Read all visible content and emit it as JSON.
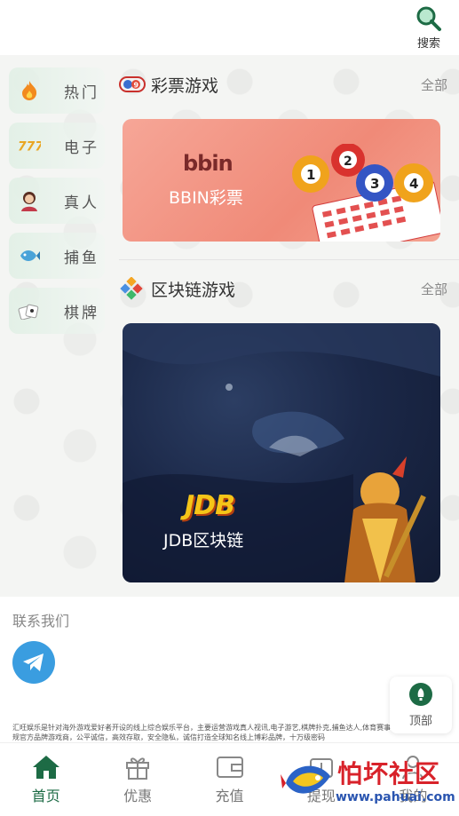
{
  "header": {
    "search_label": "搜索"
  },
  "sidebar": {
    "items": [
      {
        "label": "热门",
        "icon": "fire-icon"
      },
      {
        "label": "电子",
        "icon": "slot-777-icon"
      },
      {
        "label": "真人",
        "icon": "live-dealer-icon"
      },
      {
        "label": "捕鱼",
        "icon": "fish-icon"
      },
      {
        "label": "棋牌",
        "icon": "cards-icon"
      }
    ]
  },
  "sections": {
    "lottery": {
      "title": "彩票游戏",
      "more": "全部",
      "card_logo": "bbin",
      "card_name": "BBIN彩票",
      "balls": [
        "1",
        "2",
        "3",
        "4"
      ]
    },
    "chain": {
      "title": "区块链游戏",
      "more": "全部",
      "card_logo": "JDB",
      "card_name": "JDB区块链"
    }
  },
  "contact": {
    "title": "联系我们",
    "footer_text": "汇旺娱乐是针对海外游戏爱好者开设的线上综合娱乐平台，主要运营游戏真人视讯,电子游艺,棋牌扑克,捕鱼达人,体育赛事等。公司对接正规官方品牌游戏商，公平诚信，高效存取，安全隐私，诚信打造全球知名线上博彩品牌，十万级密码"
  },
  "top_button": {
    "label": "顶部"
  },
  "tabbar": {
    "items": [
      {
        "label": "首页",
        "icon": "home-icon",
        "active": true
      },
      {
        "label": "优惠",
        "icon": "gift-icon",
        "active": false
      },
      {
        "label": "充值",
        "icon": "wallet-icon",
        "active": false
      },
      {
        "label": "提现",
        "icon": "withdraw-icon",
        "active": false
      },
      {
        "label": "我的",
        "icon": "user-icon",
        "active": false
      }
    ]
  },
  "watermark": {
    "text": "怕坏社区",
    "url": "www.pahuai.com"
  },
  "colors": {
    "accent": "#1d6b45",
    "lottery_card": "#f08a78",
    "chain_card": "#1b2848",
    "telegram": "#3a9de0"
  }
}
